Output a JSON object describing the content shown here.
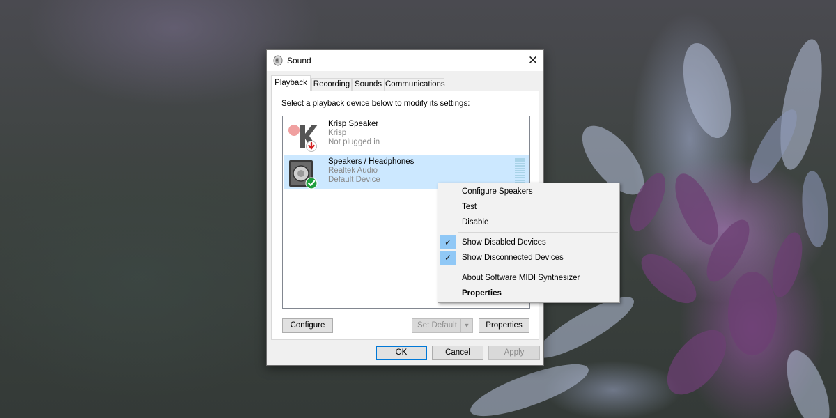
{
  "dialog": {
    "title": "Sound",
    "close_glyph": "✕",
    "tabs": [
      {
        "label": "Playback",
        "active": true
      },
      {
        "label": "Recording",
        "active": false
      },
      {
        "label": "Sounds",
        "active": false
      },
      {
        "label": "Communications",
        "active": false
      }
    ],
    "instruction": "Select a playback device below to modify its settings:",
    "devices": [
      {
        "name": "Krisp Speaker",
        "driver": "Krisp",
        "status": "Not plugged in",
        "icon": "krisp-speaker-icon",
        "badge": "unplugged-arrow-icon",
        "selected": false
      },
      {
        "name": "Speakers / Headphones",
        "driver": "Realtek Audio",
        "status": "Default Device",
        "icon": "speaker-icon",
        "badge": "default-check-icon",
        "selected": true
      }
    ],
    "buttons": {
      "configure": "Configure",
      "set_default": "Set Default",
      "properties": "Properties",
      "ok": "OK",
      "cancel": "Cancel",
      "apply": "Apply"
    }
  },
  "context_menu": {
    "items": [
      {
        "label": "Configure Speakers",
        "checked": false,
        "bold": false
      },
      {
        "label": "Test",
        "checked": false,
        "bold": false
      },
      {
        "label": "Disable",
        "checked": false,
        "bold": false
      },
      {
        "label": "Show Disabled Devices",
        "checked": true,
        "bold": false
      },
      {
        "label": "Show Disconnected Devices",
        "checked": true,
        "bold": false
      },
      {
        "label": "About Software MIDI Synthesizer",
        "checked": false,
        "bold": false
      },
      {
        "label": "Properties",
        "checked": false,
        "bold": true
      }
    ],
    "check_glyph": "✓"
  },
  "colors": {
    "selection": "#cce8ff",
    "accent": "#0078d7",
    "menu_check_bg": "#90c8f6"
  }
}
